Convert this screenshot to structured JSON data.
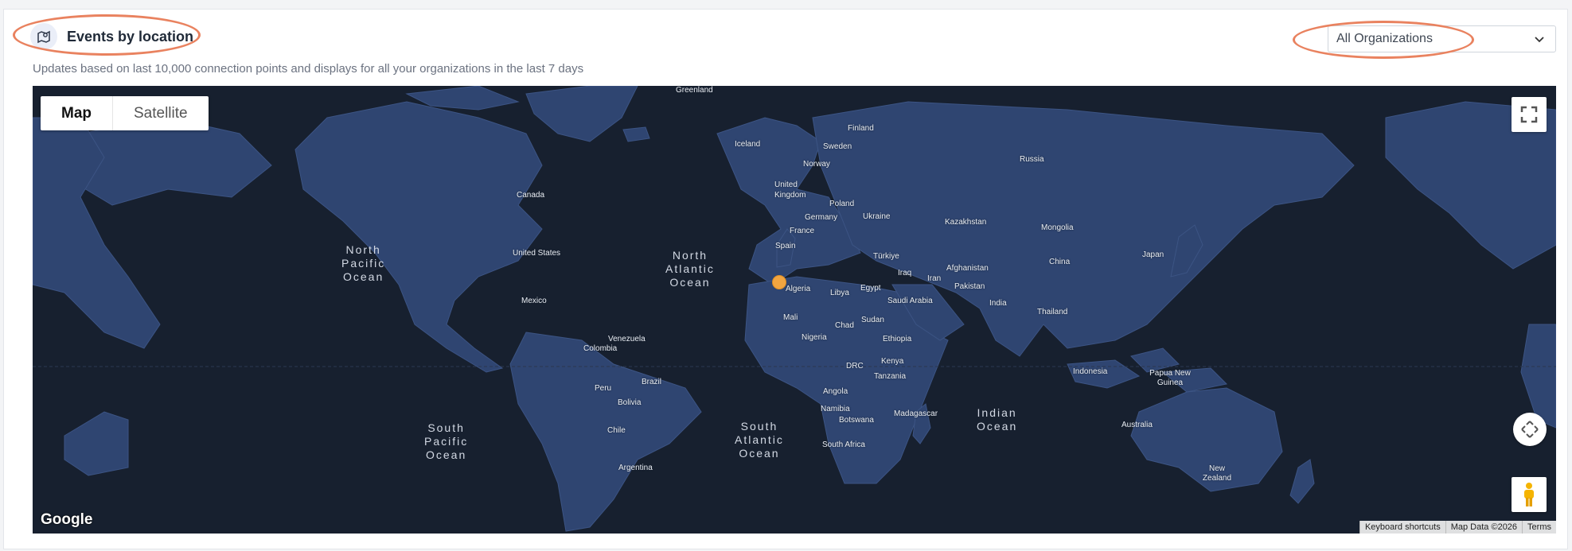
{
  "header": {
    "title": "Events by location",
    "subtitle": "Updates based on last 10,000 connection points and displays for all your organizations in the last 7 days"
  },
  "org_select": {
    "value": "All Organizations"
  },
  "map": {
    "type_buttons": {
      "map": "Map",
      "satellite": "Satellite"
    },
    "google_logo": "Google",
    "attribution": {
      "shortcuts": "Keyboard shortcuts",
      "data": "Map Data ©2026",
      "terms": "Terms"
    },
    "countries": {
      "greenland": "Greenland",
      "iceland": "Iceland",
      "finland": "Finland",
      "sweden": "Sweden",
      "norway": "Norway",
      "united_kingdom": "United Kingdom",
      "russia": "Russia",
      "canada": "Canada",
      "poland": "Poland",
      "germany": "Germany",
      "ukraine": "Ukraine",
      "kazakhstan": "Kazakhstan",
      "mongolia": "Mongolia",
      "france": "France",
      "spain": "Spain",
      "turkiye": "Türkiye",
      "united_states": "United States",
      "japan": "Japan",
      "china": "China",
      "afghanistan": "Afghanistan",
      "iraq": "Iraq",
      "iran": "Iran",
      "pakistan": "Pakistan",
      "algeria": "Algeria",
      "libya": "Libya",
      "egypt": "Egypt",
      "saudi_arabia": "Saudi Arabia",
      "india": "India",
      "mexico": "Mexico",
      "thailand": "Thailand",
      "mali": "Mali",
      "chad": "Chad",
      "sudan": "Sudan",
      "nigeria": "Nigeria",
      "ethiopia": "Ethiopia",
      "venezuela": "Venezuela",
      "colombia": "Colombia",
      "drc": "DRC",
      "kenya": "Kenya",
      "indonesia": "Indonesia",
      "papua_new_guinea": "Papua New Guinea",
      "tanzania": "Tanzania",
      "brazil": "Brazil",
      "peru": "Peru",
      "angola": "Angola",
      "bolivia": "Bolivia",
      "namibia": "Namibia",
      "madagascar": "Madagascar",
      "botswana": "Botswana",
      "australia": "Australia",
      "chile": "Chile",
      "south_africa": "South Africa",
      "argentina": "Argentina",
      "new_zealand": "New Zealand"
    },
    "oceans": {
      "north_pacific": "North\nPacific\nOcean",
      "north_atlantic": "North\nAtlantic\nOcean",
      "south_pacific": "South\nPacific\nOcean",
      "south_atlantic": "South\nAtlantic\nOcean",
      "indian": "Indian\nOcean"
    }
  },
  "colors": {
    "annotation": "#e9825f",
    "ocean": "#17202f",
    "land": "#2f4571",
    "marker": "#f2a540"
  }
}
